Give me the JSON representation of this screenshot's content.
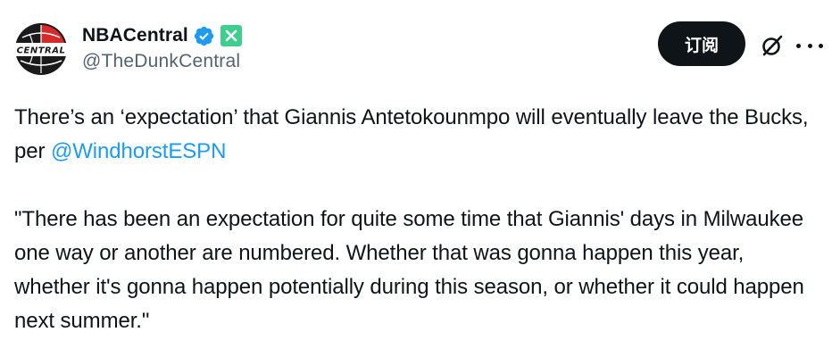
{
  "author": {
    "display_name": "NBACentral",
    "handle": "@TheDunkCentral",
    "avatar_text": "CENTRAL",
    "verified": true,
    "verified_color": "#1d9bf0",
    "affiliate_badge_color": "#3ecf8e"
  },
  "actions": {
    "subscribe_label": "订阅",
    "grok_icon": "grok-icon",
    "more_icon": "more-icon"
  },
  "tweet": {
    "paragraph1_text": "There’s an ‘expectation’ that Giannis Antetokounmpo will eventually leave the Bucks, per ",
    "paragraph1_mention": "@WindhorstESPN",
    "paragraph2_text": "\"There has been an expectation for quite some time that Giannis' days in Milwaukee one way or another are numbered. Whether that was gonna happen this year, whether it's gonna happen potentially during this season, or whether it could happen next summer.\""
  },
  "colors": {
    "text": "#0f1419",
    "secondary_text": "#536471",
    "link": "#1d9bf0",
    "button_bg": "#0f1419"
  }
}
